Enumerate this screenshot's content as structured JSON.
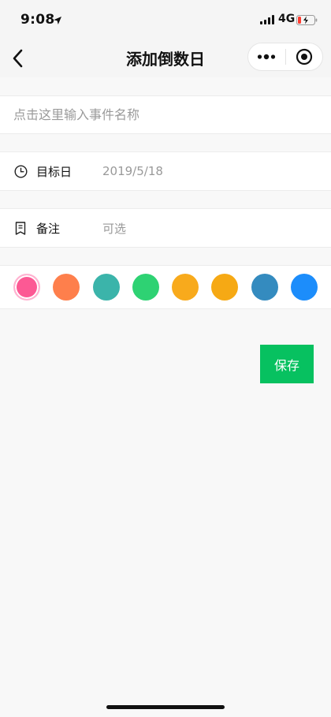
{
  "status_bar": {
    "time": "9:08",
    "network": "4G"
  },
  "nav": {
    "title": "添加倒数日"
  },
  "form": {
    "name_placeholder": "点击这里输入事件名称",
    "target_date": {
      "label": "目标日",
      "value": "2019/5/18"
    },
    "note": {
      "label": "备注",
      "value": "可选"
    },
    "color_options": [
      "#fc5994",
      "#fe7f4c",
      "#3bb4aa",
      "#2ed273",
      "#f8aa1c",
      "#f6a914",
      "#348bbf",
      "#1c8dfb"
    ],
    "selected_color_index": 0
  },
  "actions": {
    "save_label": "保存"
  },
  "icons": {
    "back": "chevron-left-icon",
    "more": "more-dots-icon",
    "close": "target-circle-icon",
    "clock": "clock-icon",
    "note": "note-icon",
    "location": "location-arrow-icon",
    "signal": "signal-icon",
    "battery": "battery-charging-icon"
  }
}
